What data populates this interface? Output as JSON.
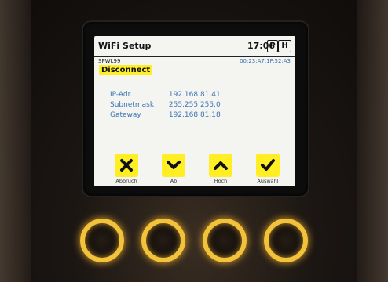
{
  "screen": {
    "title": "WiFi Setup",
    "clock": "17:06",
    "mode_badge": "H",
    "mode_prefix": "P",
    "ssid": "SPWL99",
    "mac": "00:23:A7:1F:52:A3",
    "disconnect_label": "Disconnect",
    "info": [
      {
        "label": "IP-Adr.",
        "value": "192.168.81.41"
      },
      {
        "label": "Subnetmask",
        "value": "255.255.255.0"
      },
      {
        "label": "Gateway",
        "value": "192.168.81.18"
      }
    ],
    "softkeys": [
      {
        "label": "Abbruch",
        "icon": "close-icon"
      },
      {
        "label": "Ab",
        "icon": "chevron-down-icon"
      },
      {
        "label": "Hoch",
        "icon": "chevron-up-icon"
      },
      {
        "label": "Auswahl",
        "icon": "check-icon"
      }
    ]
  },
  "colors": {
    "softkey_yellow": "#ffee24",
    "info_blue": "#3a73b8",
    "ring_gold": "#f2c23a"
  }
}
